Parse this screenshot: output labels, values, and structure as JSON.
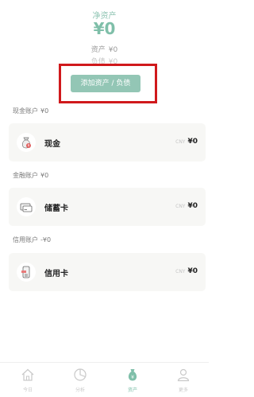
{
  "summary": {
    "net_worth_label": "净资产",
    "net_worth_value": "¥0",
    "assets_label": "资产",
    "assets_value": "¥0",
    "liabilities_label": "负债",
    "liabilities_value": "¥0",
    "add_button_label": "添加资产 / 负债"
  },
  "sections": [
    {
      "title": "现金账户",
      "total": "¥0",
      "account": {
        "name": "现金",
        "currency": "CNY",
        "amount": "¥0",
        "icon": "cash-bag-icon"
      }
    },
    {
      "title": "金融账户",
      "total": "¥0",
      "account": {
        "name": "储蓄卡",
        "currency": "CNY",
        "amount": "¥0",
        "icon": "debit-card-icon"
      }
    },
    {
      "title": "信用账户",
      "total": "-¥0",
      "account": {
        "name": "信用卡",
        "currency": "CNY",
        "amount": "¥0",
        "icon": "credit-card-icon"
      }
    }
  ],
  "tabbar": {
    "items": [
      {
        "label": "今日",
        "icon": "home-icon"
      },
      {
        "label": "分析",
        "icon": "pie-chart-icon"
      },
      {
        "label": "资产",
        "icon": "money-bag-icon"
      },
      {
        "label": "更多",
        "icon": "user-icon"
      }
    ],
    "active_index": 2
  },
  "colors": {
    "accent": "#7fbfa9",
    "button": "#93c6b5",
    "highlight": "#d0191c"
  }
}
